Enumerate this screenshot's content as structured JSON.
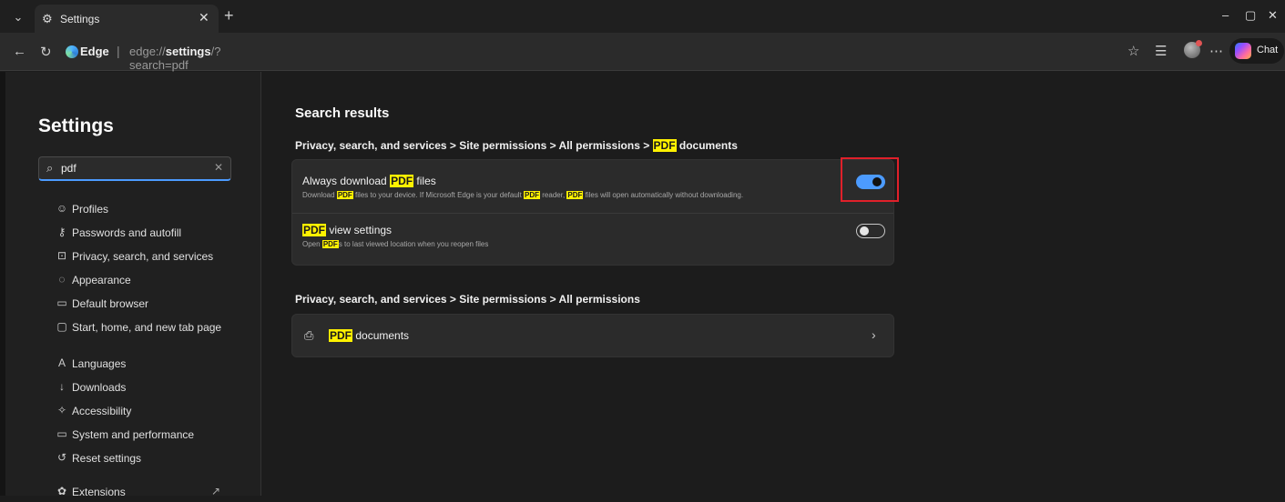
{
  "browser": {
    "tab_title": "Settings",
    "url_brand": "Edge",
    "url_prefix": "edge://",
    "url_bold": "settings",
    "url_suffix": "/?search=pdf",
    "chat_label": "Chat"
  },
  "sidebar": {
    "title": "Settings",
    "search_value": "pdf",
    "items": [
      {
        "label": "Profiles",
        "icon": "profile-icon"
      },
      {
        "label": "Passwords and autofill",
        "icon": "key-icon"
      },
      {
        "label": "Privacy, search, and services",
        "icon": "lock-icon"
      },
      {
        "label": "Appearance",
        "icon": "appearance-icon"
      },
      {
        "label": "Default browser",
        "icon": "browser-icon"
      },
      {
        "label": "Start, home, and new tab page",
        "icon": "home-tab-icon"
      },
      {
        "label": "Languages",
        "icon": "languages-icon"
      },
      {
        "label": "Downloads",
        "icon": "download-icon"
      },
      {
        "label": "Accessibility",
        "icon": "accessibility-icon"
      },
      {
        "label": "System and performance",
        "icon": "system-icon"
      },
      {
        "label": "Reset settings",
        "icon": "reset-icon"
      },
      {
        "label": "Extensions",
        "icon": "extensions-icon"
      }
    ]
  },
  "main": {
    "heading": "Search results",
    "crumb1_prefix": "Privacy, search, and services  >  Site permissions  >  All permissions  >",
    "crumb1_hl": "PDF",
    "crumb1_suffix": "documents",
    "row1": {
      "title_prefix": "Always download",
      "title_hl": "PDF",
      "title_suffix": "files",
      "desc_a": "Download",
      "desc_hl1": "PDF",
      "desc_b": "files to your device. If Microsoft Edge is your default",
      "desc_hl2": "PDF",
      "desc_c": "reader,",
      "desc_hl3": "PDF",
      "desc_d": "files will open automatically without downloading.",
      "toggle_on": true
    },
    "row2": {
      "title_hl": "PDF",
      "title_suffix": "view settings",
      "desc_a": "Open",
      "desc_hl": "PDF",
      "desc_b": "s to last viewed location when you reopen files",
      "toggle_on": false
    },
    "crumb2": "Privacy, search, and services  >  Site permissions  >  All permissions",
    "link_row": {
      "hl": "PDF",
      "label": "documents"
    }
  },
  "colors": {
    "accent": "#4c9bff",
    "highlight": "#fff100",
    "annotation": "#e0202a"
  }
}
